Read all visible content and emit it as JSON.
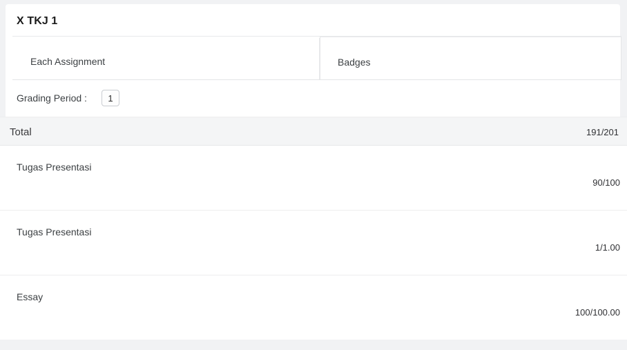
{
  "card": {
    "title": "X TKJ 1"
  },
  "tabs": [
    {
      "label": "Each Assignment",
      "active": false
    },
    {
      "label": "Badges",
      "active": true
    }
  ],
  "grading_period": {
    "label": "Grading Period :",
    "value": "1"
  },
  "total": {
    "label": "Total",
    "value": "191/201"
  },
  "assignments": [
    {
      "name": "Tugas Presentasi",
      "score": "90/100"
    },
    {
      "name": "Tugas Presentasi",
      "score": "1/1.00"
    },
    {
      "name": "Essay",
      "score": "100/100.00"
    }
  ],
  "colors": {
    "page_background": "#f1f2f4",
    "card_background": "#ffffff",
    "total_row_background": "#f4f5f6",
    "border": "#e4e5e7",
    "text_primary": "#3c4043",
    "text_title": "#1b1b1b"
  }
}
